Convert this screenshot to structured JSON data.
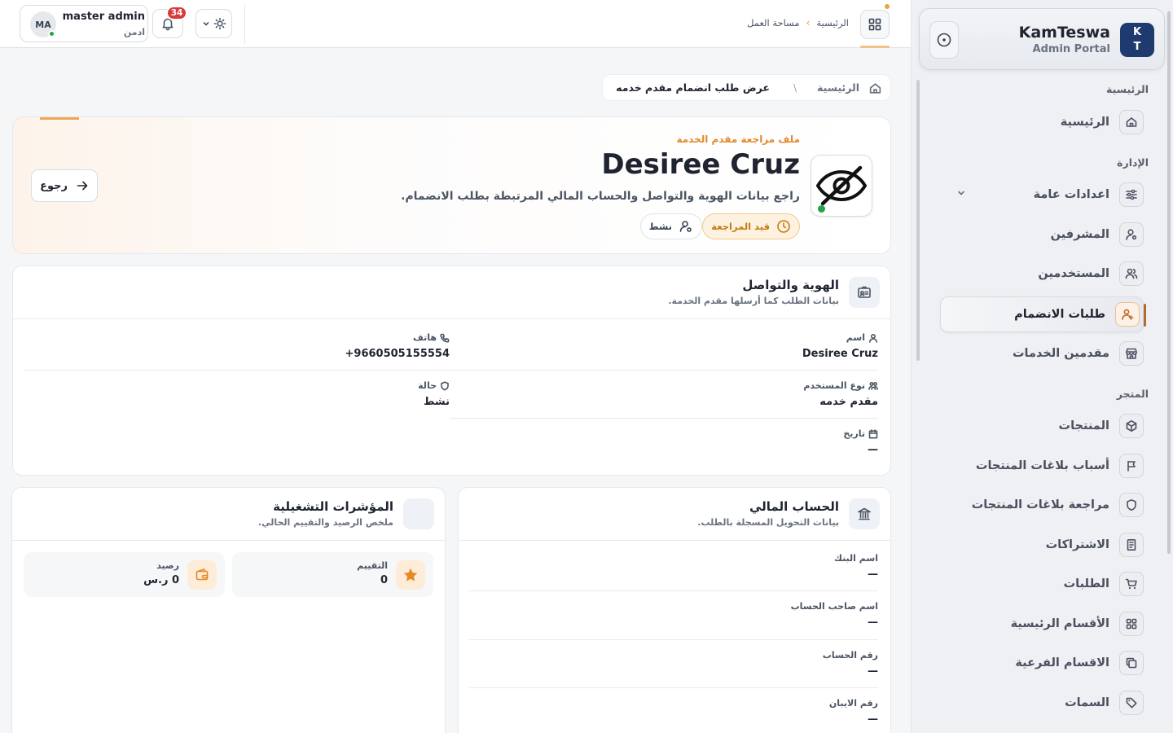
{
  "brand": {
    "logo": [
      "K",
      "T"
    ],
    "title": "KamTeswa",
    "subtitle": "Admin Portal"
  },
  "sidebar": {
    "sections": [
      {
        "label": "الرئيسية"
      },
      {
        "label": "الإدارة"
      },
      {
        "label": "المتجر"
      }
    ],
    "items": [
      {
        "label": "الرئيسية",
        "icon": "home-icon"
      },
      {
        "label": "اعدادات عامة",
        "icon": "sliders-icon"
      },
      {
        "label": "المشرفين",
        "icon": "user-gear-icon"
      },
      {
        "label": "المستخدمين",
        "icon": "users-icon"
      },
      {
        "label": "طلبات الانضمام",
        "icon": "user-plus-icon",
        "active": true
      },
      {
        "label": "مقدمين الخدمات",
        "icon": "store-icon"
      },
      {
        "label": "المنتجات",
        "icon": "box-icon"
      },
      {
        "label": "أسباب بلاغات المنتجات",
        "icon": "flag-icon"
      },
      {
        "label": "مراجعة بلاغات المنتجات",
        "icon": "shield-icon"
      },
      {
        "label": "الاشتراكات",
        "icon": "receipt-icon"
      },
      {
        "label": "الطلبات",
        "icon": "cart-icon"
      },
      {
        "label": "الأقسام الرئيسية",
        "icon": "grid-icon"
      },
      {
        "label": "الاقسام الفرعية",
        "icon": "layers-icon"
      },
      {
        "label": "السمات",
        "icon": "tag-icon"
      }
    ]
  },
  "header": {
    "breadcrumb": [
      "الرئيسية",
      "مساحة العمل"
    ],
    "notifications_count": "34",
    "user": {
      "initials": "MA",
      "name": "master admin",
      "role": "ادمن"
    }
  },
  "page_crumb": {
    "root": "الرئيسية",
    "separator": "\\",
    "current": "عرض طلب انضمام مقدم خدمه"
  },
  "hero": {
    "eyebrow": "ملف مراجعة مقدم الخدمة",
    "name": "Desiree Cruz",
    "description": "راجع بيانات الهوية والتواصل والحساب المالي المرتبطة بطلب الانضمام.",
    "status_review": "قيد المراجعة",
    "status_active": "نشط",
    "back_label": "رجوع"
  },
  "identity": {
    "title": "الهوية والتواصل",
    "subtitle": "بيانات الطلب كما أرسلها مقدم الخدمة.",
    "name_label": "اسم",
    "name_value": "Desiree Cruz",
    "phone_label": "هاتف",
    "phone_value": "+9660505155554",
    "type_label": "نوع المستخدم",
    "type_value": "مقدم خدمه",
    "status_label": "حالة",
    "status_value": "نشط",
    "date_label": "تاريخ",
    "date_value": "—"
  },
  "finance": {
    "title": "الحساب المالي",
    "subtitle": "بيانات التحويل المسجلة بالطلب.",
    "bank_label": "اسم البنك",
    "bank_value": "—",
    "holder_label": "اسم صاحب الحساب",
    "holder_value": "—",
    "account_label": "رقم الحساب",
    "account_value": "—",
    "iban_label": "رقم الايبان",
    "iban_value": "—"
  },
  "metrics": {
    "title": "المؤشرات التشغيلية",
    "subtitle": "ملخص الرصيد والتقييم الحالي.",
    "rating_label": "التقييم",
    "rating_value": "0",
    "balance_label": "رصيد",
    "balance_value": "0 ر.س"
  },
  "colors": {
    "accent": "#e28a2b",
    "brand": "#1e3a6e",
    "online": "#22a447",
    "badge": "#d93b3b"
  }
}
